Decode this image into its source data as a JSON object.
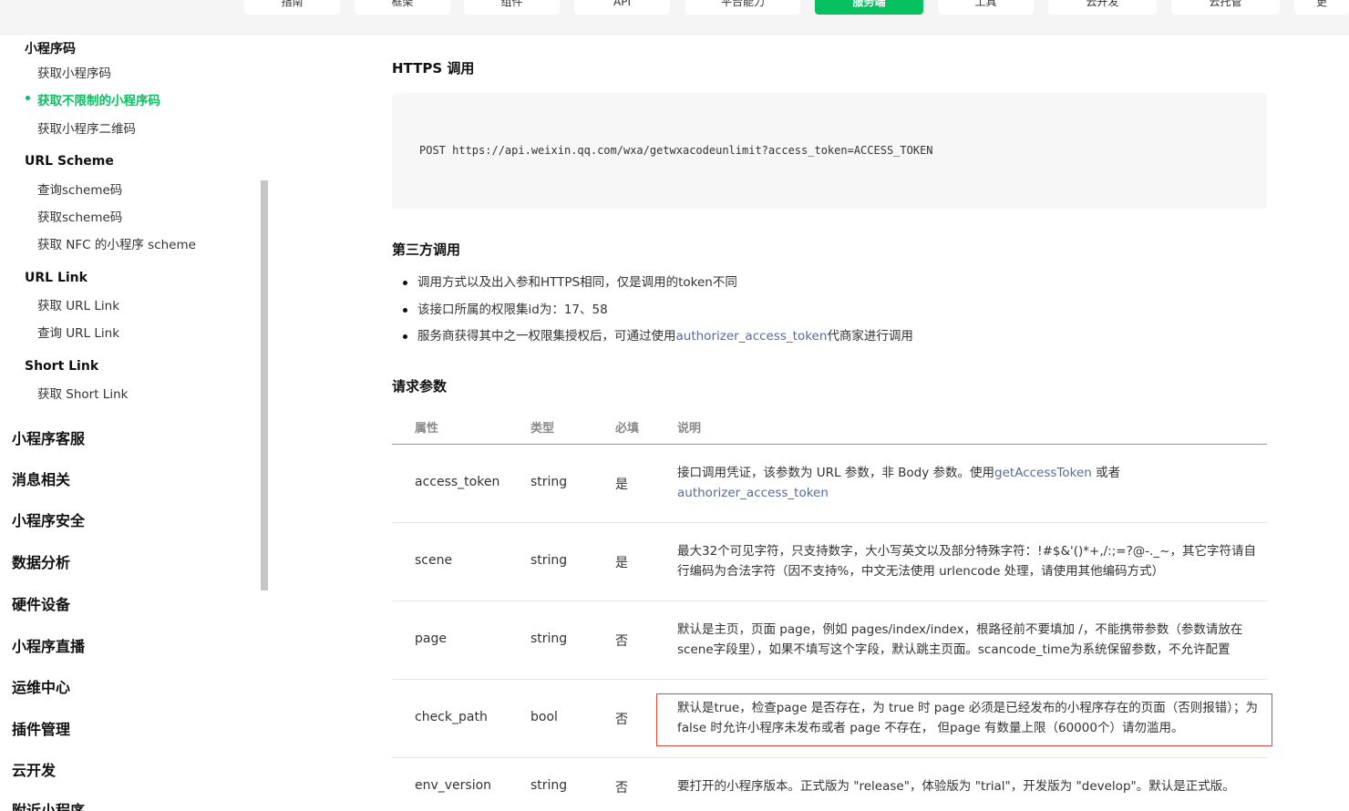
{
  "top_nav": {
    "tabs": [
      {
        "label": "指南"
      },
      {
        "label": "框架"
      },
      {
        "label": "组件"
      },
      {
        "label": "API"
      },
      {
        "label": "平台能力"
      },
      {
        "label": "服务端"
      },
      {
        "label": "工具"
      },
      {
        "label": "云开发"
      },
      {
        "label": "云托管"
      },
      {
        "label": "更"
      }
    ]
  },
  "sidebar": {
    "group_miniprogram_code": "小程序码",
    "item_get_code": "获取小程序码",
    "item_get_unlimited": "获取不限制的小程序码",
    "item_get_qrcode": "获取小程序二维码",
    "group_url_scheme": "URL Scheme",
    "item_query_scheme": "查询scheme码",
    "item_get_scheme": "获取scheme码",
    "item_get_nfc_scheme": "获取 NFC 的小程序 scheme",
    "group_url_link": "URL Link",
    "item_get_url_link": "获取 URL Link",
    "item_query_url_link": "查询 URL Link",
    "group_short_link": "Short Link",
    "item_get_short_link": "获取 Short Link",
    "top_items": [
      "小程序客服",
      "消息相关",
      "小程序安全",
      "数据分析",
      "硬件设备",
      "小程序直播",
      "运维中心",
      "插件管理",
      "云开发",
      "附近小程序"
    ]
  },
  "main": {
    "https_heading": "HTTPS 调用",
    "https_code": "POST https://api.weixin.qq.com/wxa/getwxacodeunlimit?access_token=ACCESS_TOKEN",
    "third_party_heading": "第三方调用",
    "bullet_1": "调用方式以及出入参和HTTPS相同，仅是调用的token不同",
    "bullet_2": "该接口所属的权限集id为：17、58",
    "bullet_3_prefix": "服务商获得其中之一权限集授权后，可通过使用",
    "bullet_3_link": "authorizer_access_token",
    "bullet_3_suffix": "代商家进行调用",
    "params_heading": "请求参数",
    "table": {
      "headers": {
        "name": "属性",
        "type": "类型",
        "required": "必填",
        "desc": "说明"
      },
      "rows": [
        {
          "name": "access_token",
          "type": "string",
          "required": "是",
          "desc_prefix": "接口调用凭证，该参数为 URL 参数，非 Body 参数。使用",
          "desc_link1": "getAccessToken",
          "desc_mid": " 或者",
          "desc_link2": "authorizer_access_token"
        },
        {
          "name": "scene",
          "type": "string",
          "required": "是",
          "desc": "最大32个可见字符，只支持数字，大小写英文以及部分特殊字符：!#$&'()*+,/:;=?@-._~，其它字符请自行编码为合法字符（因不支持%，中文无法使用 urlencode 处理，请使用其他编码方式）"
        },
        {
          "name": "page",
          "type": "string",
          "required": "否",
          "desc": "默认是主页，页面 page，例如 pages/index/index，根路径前不要填加 /，不能携带参数（参数请放在scene字段里），如果不填写这个字段，默认跳主页面。scancode_time为系统保留参数，不允许配置"
        },
        {
          "name": "check_path",
          "type": "bool",
          "required": "否",
          "desc": "默认是true，检查page 是否存在，为 true 时 page 必须是已经发布的小程序存在的页面（否则报错）；为 false 时允许小程序未发布或者 page 不存在， 但page 有数量上限（60000个）请勿滥用。"
        },
        {
          "name": "env_version",
          "type": "string",
          "required": "否",
          "desc": "要打开的小程序版本。正式版为 \"release\"，体验版为 \"trial\"，开发版为 \"develop\"。默认是正式版。"
        }
      ]
    }
  },
  "colors": {
    "accent": "#07c160",
    "link": "#576b95",
    "highlight_border": "#d9443b"
  }
}
